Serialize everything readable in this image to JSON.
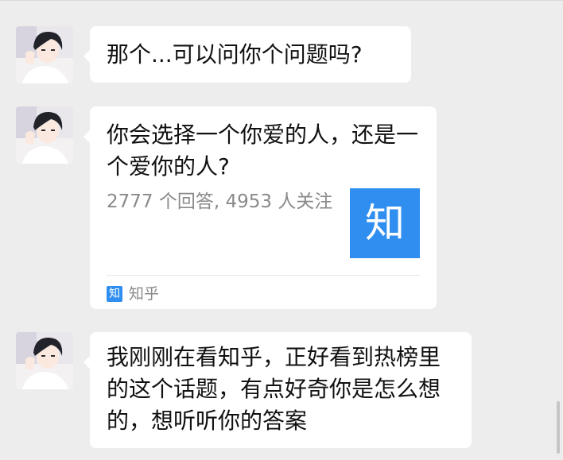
{
  "messages": [
    {
      "text": "那个...可以问你个问题吗?"
    },
    {
      "card": {
        "title": "你会选择一个你爱的人，还是一个爱你的人?",
        "meta": "2777 个回答, 4953 人关注",
        "thumb_glyph": "知",
        "source_icon_glyph": "知",
        "source_name": "知乎"
      }
    },
    {
      "text": "我刚刚在看知乎，正好看到热榜里的这个话题，有点好奇你是怎么想的，想听听你的答案"
    }
  ],
  "colors": {
    "background": "#ededed",
    "bubble": "#ffffff",
    "brand_blue": "#2f8ef0",
    "secondary_text": "#8a8a8a"
  },
  "icons": [
    "user-avatar",
    "zhihu-logo-icon"
  ]
}
